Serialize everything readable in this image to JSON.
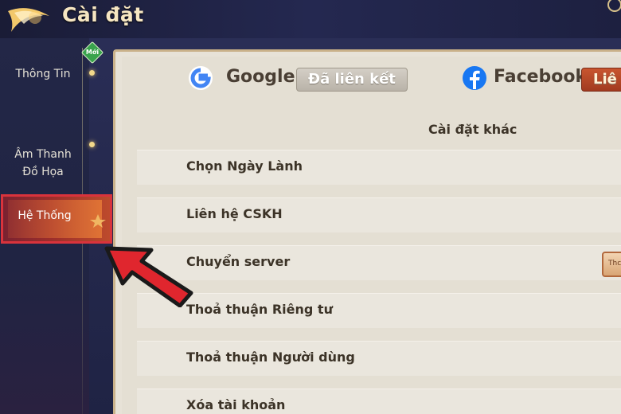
{
  "header": {
    "title": "Cài đặt"
  },
  "sidebar": {
    "badge": "Mới",
    "items": [
      {
        "label": "Thông Tin"
      },
      {
        "label": "Âm Thanh\nĐồ Họa"
      },
      {
        "label": "Hệ Thống",
        "active": true
      }
    ]
  },
  "accounts": {
    "google": {
      "name": "Google",
      "status": "Đã liên kết"
    },
    "facebook": {
      "name": "Facebook",
      "status": "Liê"
    }
  },
  "section": {
    "title": "Cài đặt khác"
  },
  "rows": [
    {
      "label": "Chọn Ngày Lành"
    },
    {
      "label": "Liên hệ CSKH"
    },
    {
      "label": "Chuyển server",
      "button": "Thc"
    },
    {
      "label": "Thoả thuận Riêng tư"
    },
    {
      "label": "Thoả thuận Người dùng"
    },
    {
      "label": "Xóa tài khoản"
    }
  ],
  "colors": {
    "accent": "#d9333c",
    "panel": "#e7e2d7",
    "text": "#3c3327",
    "arrow": "#e0262e"
  }
}
